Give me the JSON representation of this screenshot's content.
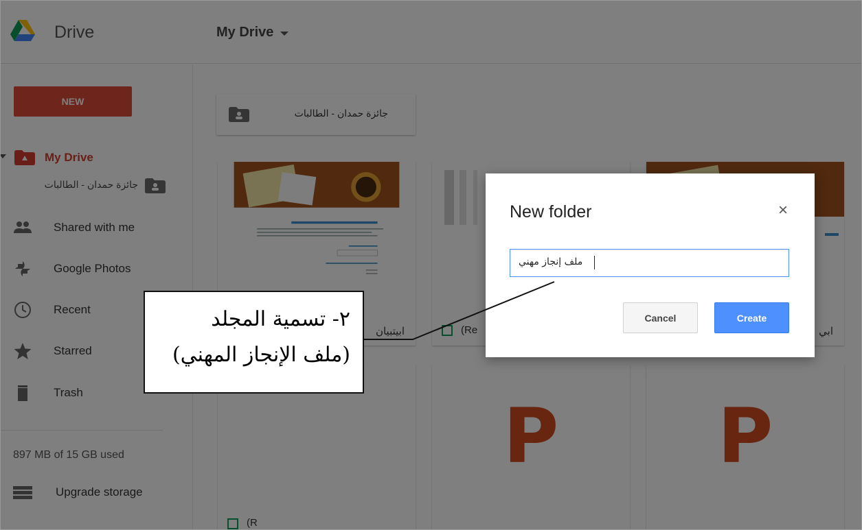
{
  "app": {
    "name": "Drive",
    "location": "My Drive"
  },
  "sidebar": {
    "new_label": "NEW",
    "my_drive": "My Drive",
    "subfolder": "جائزة حمدان - الطالبات",
    "items": [
      {
        "label": "Shared with me",
        "icon": "shared-with-me-icon"
      },
      {
        "label": "Google Photos",
        "icon": "google-photos-icon"
      },
      {
        "label": "Recent",
        "icon": "clock-icon"
      },
      {
        "label": "Starred",
        "icon": "star-icon"
      },
      {
        "label": "Trash",
        "icon": "trash-icon"
      }
    ],
    "storage": "897 MB of 15 GB used",
    "upgrade": "Upgrade storage"
  },
  "content": {
    "folder": "جائزة حمدان - الطالبات",
    "cards": [
      {
        "name": "ابيتبيان",
        "type": "document"
      },
      {
        "name": "(Re",
        "type": "spreadsheet"
      },
      {
        "name": "ابي",
        "type": "document"
      },
      {
        "name": "",
        "type": "spreadsheet"
      },
      {
        "name": "",
        "type": "presentation",
        "letter": "P"
      },
      {
        "name": "",
        "type": "presentation",
        "letter": "P"
      }
    ],
    "bottom_row_labels": [
      "(R",
      "",
      ""
    ]
  },
  "dialog": {
    "title": "New folder",
    "close_glyph": "×",
    "input_value": "ملف إنجاز مهني",
    "cancel_label": "Cancel",
    "create_label": "Create"
  },
  "annotation": {
    "line1": "٢- تسمية المجلد",
    "line2": "(ملف الإنجاز المهني)"
  },
  "colors": {
    "new_button": "#dd4b39",
    "my_drive_label": "#d23f31",
    "create_button": "#4d90fe",
    "presentation_letter": "#d04a20",
    "sheet_icon": "#0f9d58"
  }
}
